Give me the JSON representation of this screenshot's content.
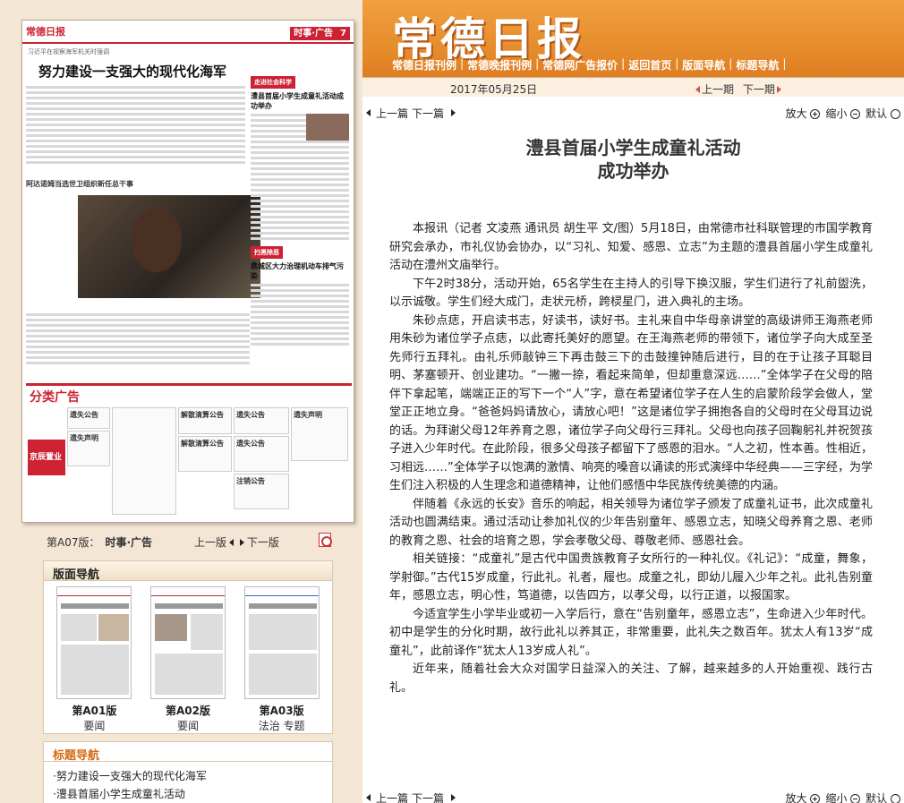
{
  "header": {
    "logo": "常德日报",
    "nav": [
      "常德日报刊例",
      "常德晚报刊例",
      "常德网广告报价",
      "返回首页",
      "版面导航",
      "标题导航"
    ],
    "date": "2017年05月25日",
    "issue_prev": "上一期",
    "issue_next": "下一期"
  },
  "paper_thumb": {
    "logo": "常德日报",
    "section_tag": "时事·广告",
    "page_num": "7",
    "kicker": "习近平在视察海军机关时强调",
    "headline": "努力建设一支强大的现代化海军",
    "side_tag": "走进社会科学",
    "side_title": "澧县首届小学生成童礼活动成功举办",
    "photo_caption": "阿达诺姆当选世卫组织新任总干事",
    "side_tag2": "扫黑除恶",
    "side_title2": "鼎城区大力治理机动车排气污染",
    "ad_title": "分类广告",
    "ad_left": "京辰置业",
    "ad_boxes": [
      "遗失公告",
      "遗失声明",
      "解散清算公告",
      "遗失公告",
      "遗失声明",
      "解散清算公告",
      "遗失公告",
      "注销公告"
    ]
  },
  "page_info": {
    "page": "第A07版：",
    "section": "时事·广告",
    "prev": "上一版",
    "next": "下一版"
  },
  "page_nav_panel": {
    "title": "版面导航",
    "pages": [
      {
        "label": "第A01版",
        "sub": "要闻"
      },
      {
        "label": "第A02版",
        "sub": "要闻"
      },
      {
        "label": "第A03版",
        "sub": "法治 专题"
      }
    ]
  },
  "title_nav_panel": {
    "title": "标题导航",
    "items": [
      "·努力建设一支强大的现代化海军",
      "·澧县首届小学生成童礼活动"
    ]
  },
  "toolbar": {
    "prev": "上一篇",
    "next": "下一篇",
    "zoom_in": "放大",
    "zoom_out": "缩小",
    "default": "默认"
  },
  "article": {
    "title_line1": "澧县首届小学生成童礼活动",
    "title_line2": "成功举办",
    "paragraphs": [
      "本报讯（记者 文凌燕 通讯员 胡生平 文/图）5月18日，由常德市社科联管理的市国学教育研究会承办，市礼仪协会协办，以“习礼、知爱、感恩、立志”为主题的澧县首届小学生成童礼活动在澧州文庙举行。",
      "下午2时38分，活动开始，65名学生在主持人的引导下换汉服，学生们进行了礼前盥洗，以示诚敬。学生们经大成门，走状元桥，跨棂星门，进入典礼的主场。",
      "朱砂点痣，开启读书志，好读书，读好书。主礼来自中华母亲讲堂的高级讲师王海燕老师用朱砂为诸位学子点痣，以此寄托美好的愿望。在王海燕老师的带领下，诸位学子向大成至圣先师行五拜礼。由礼乐师敲钟三下再击鼓三下的击鼓撞钟随后进行，目的在于让孩子耳聪目明、茅塞顿开、创业建功。“一撇一捺，看起来简单，但却重意深远……”全体学子在父母的陪伴下拿起笔，端端正正的写下一个“人”字，意在希望诸位学子在人生的启蒙阶段学会做人，堂堂正正地立身。“爸爸妈妈请放心，请放心吧！”这是诸位学子拥抱各自的父母时在父母耳边说的话。为拜谢父母12年养育之恩，诸位学子向父母行三拜礼。父母也向孩子回鞠躬礼并祝贺孩子进入少年时代。在此阶段，很多父母孩子都留下了感恩的泪水。“人之初，性本善。性相近，习相远……”全体学子以饱满的激情、响亮的嗓音以诵读的形式演绎中华经典——三字经，为学生们注入积极的人生理念和道德精神，让他们感悟中华民族传统美德的内涵。",
      "伴随着《永远的长安》音乐的响起，相关领导为诸位学子颁发了成童礼证书，此次成童礼活动也圆满结束。通过活动让参加礼仪的少年告别童年、感恩立志，知晓父母养育之恩、老师的教育之恩、社会的培育之恩，学会孝敬父母、尊敬老师、感恩社会。",
      "相关链接：“成童礼”是古代中国贵族教育子女所行的一种礼仪。《礼记》：“成童，舞象，学射御。”古代15岁成童，行此礼。礼者，履也。成童之礼，即幼儿履入少年之礼。此礼告别童年，感恩立志，明心性，笃道德，以告四方，以孝父母，以行正道，以报国家。",
      "今适宜学生小学毕业或初一入学后行，意在“告别童年，感恩立志”，生命进入少年时代。初中是学生的分化时期，故行此礼以养其正，非常重要，此礼失之数百年。犹太人有13岁“成童礼”，此前译作“犹太人13岁成人礼”。",
      "近年来，随着社会大众对国学日益深入的关注、了解，越来越多的人开始重视、践行古礼。"
    ]
  }
}
